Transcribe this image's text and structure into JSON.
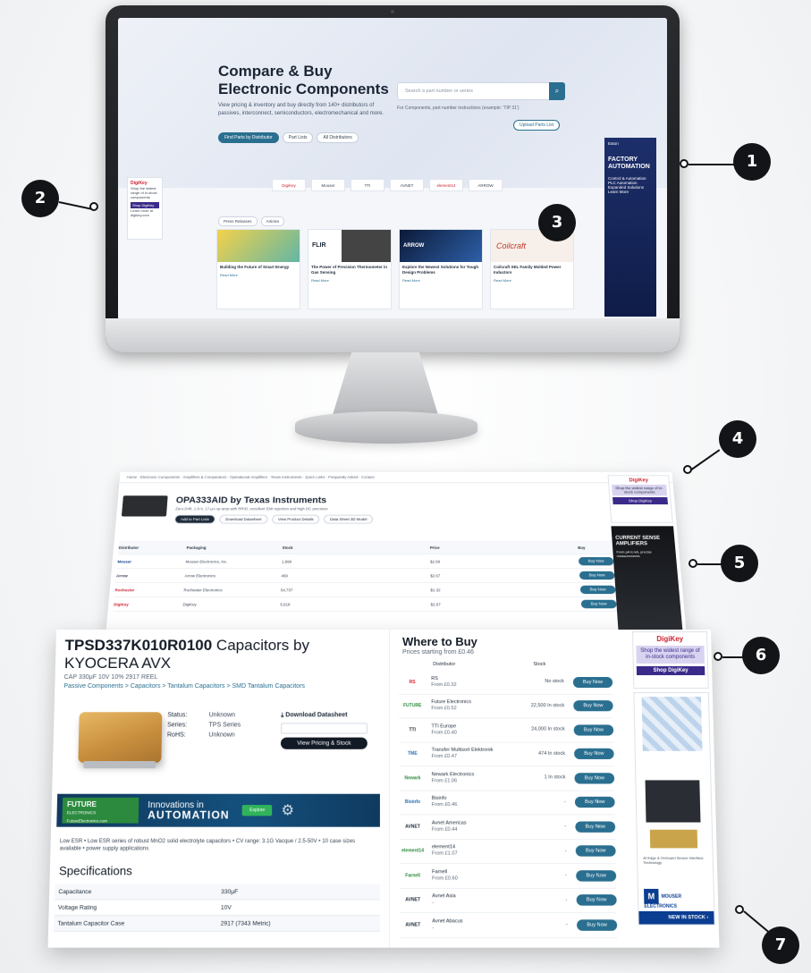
{
  "monitor": {
    "hero": {
      "title": "Compare & Buy Electronic Components",
      "subtitle": "View pricing & inventory and buy directly from 140+ distributors of passives, interconnect, semiconductors, electromechanical and more.",
      "buttons": [
        "Find Parts by Distributor",
        "Part Lists",
        "All Distributors"
      ],
      "search_placeholder": "Search a part number or series",
      "search_note": "For Components, part number instructions (example: 'TIP 31')",
      "upload_label": "Upload Parts List"
    },
    "ad_left": {
      "brand": "DigiKey",
      "text": "Shop the widest range of in-stock components",
      "cta": "Shop DigiKey",
      "note": "Learn more at digikey.com"
    },
    "ad_right": {
      "brand": "Eaton",
      "title": "FACTORY AUTOMATION",
      "items": [
        "Control & Automation",
        "PLC Automation",
        "Expanded Solutions",
        "Learn More"
      ]
    },
    "logos": [
      "DigiKey",
      "Mouser",
      "TTI",
      "AVNET",
      "element14",
      "ARROW"
    ],
    "tabs": [
      "Press Releases",
      "Articles"
    ],
    "cards": [
      {
        "title": "Building the Future of Smart Energy",
        "more": "Read More"
      },
      {
        "title": "The Power of Precision Thermometer in Gas Sensing",
        "more": "Read More"
      },
      {
        "title": "Explore the Newest Solutions for Tough Design Problems",
        "more": "Read More"
      },
      {
        "title": "Coilcraft XEL Family Molded Power Inductors",
        "more": "Read More"
      }
    ],
    "card_brands": [
      "",
      "FLIR",
      "ARROW",
      "Coilcraft"
    ]
  },
  "page1": {
    "nav": "Home · Electronic Components · Amplifiers & Comparators · Operational Amplifiers · Texas Instruments · Quick Links · Frequently Asked · Contact",
    "title": "OPA333AID by Texas Instruments",
    "desc": "Zero-Drift, 1.8-V, 17-μA op amp with RRIO, excellent EMI rejection and high DC precision",
    "buttons": [
      "Add to Part Lists",
      "Download Datasheet",
      "View Product Details",
      "Data Sheet 3D Model"
    ],
    "headers": [
      "Distributor",
      "Packaging",
      "Stock",
      "Price",
      "Buy"
    ],
    "rows": [
      {
        "dist": "Mouser",
        "name": "Mouser Electronics, Inc.",
        "stock": "1,999",
        "price": "$2.58",
        "buy": "Buy Now"
      },
      {
        "dist": "Arrow",
        "name": "Arrow Electronics",
        "stock": "469",
        "price": "$2.67",
        "buy": "Buy Now"
      },
      {
        "dist": "Rochester",
        "name": "Rochester Electronics",
        "stock": "54,737",
        "price": "$1.32",
        "buy": "Buy Now"
      },
      {
        "dist": "DigiKey",
        "name": "DigiKey",
        "stock": "5,618",
        "price": "$2.67",
        "buy": "Buy Now"
      }
    ],
    "ad1": {
      "brand": "DigiKey",
      "text": "Shop the widest range of in-stock components",
      "cta": "Shop DigiKey"
    },
    "ad2": {
      "title": "CURRENT SENSE AMPLIFIERS",
      "sub": "From pA to kA, precise measurements"
    }
  },
  "page2": {
    "title_bold": "TPSD337K010R0100",
    "title_rest": " Capacitors by KYOCERA AVX",
    "meta": "CAP 330μF 10V 10% 2917 REEL",
    "crumbs": "Passive Components > Capacitors > Tantalum Capacitors > SMD Tantalum Capacitors",
    "status": [
      {
        "k": "Status:",
        "v": "Unknown"
      },
      {
        "k": "Series:",
        "v": "TPS Series"
      },
      {
        "k": "RoHS:",
        "v": "Unknown"
      }
    ],
    "download_label": "Download Datasheet",
    "view_label": "View Pricing & Stock",
    "banner": {
      "brand": "FUTURE",
      "brand_sub": "ELECTRONICS",
      "url": "FutureElectronics.com",
      "line1": "Innovations in",
      "line2": "AUTOMATION",
      "cta": "Explore"
    },
    "desc": "Low ESR • Low ESR series of robust MnO2 solid electrolyte capacitors • CV range: 3.1G Vacque / 2.5-50V • 10 case sizes available • power supply applications",
    "spec_title": "Specifications",
    "specs": [
      {
        "k": "Capacitance",
        "v": "330μF"
      },
      {
        "k": "Voltage Rating",
        "v": "10V"
      },
      {
        "k": "Tantalum Capacitor Case",
        "v": "2917 (7343 Metric)"
      }
    ],
    "wtb": {
      "title": "Where to Buy",
      "sub": "Prices starting from £0.46",
      "col_dist": "Distributor",
      "col_stock": "Stock",
      "rows": [
        {
          "logo": "RS",
          "logo_color": "#e01e26",
          "name": "RS",
          "from": "From £0.32",
          "stock": "No stock",
          "buy": "Buy Now"
        },
        {
          "logo": "FUTURE",
          "logo_color": "#2b8a3e",
          "name": "Future Electronics",
          "from": "From £0.52",
          "stock": "22,500 In stock",
          "buy": "Buy Now"
        },
        {
          "logo": "TTI",
          "logo_color": "#1e2b3a",
          "name": "TTI Europe",
          "from": "From £0.40",
          "stock": "24,000 In stock",
          "buy": "Buy Now"
        },
        {
          "logo": "TME",
          "logo_color": "#2a6fb0",
          "name": "Transfer Multisort Elektronik",
          "from": "From £0.47",
          "stock": "474 In stock",
          "buy": "Buy Now"
        },
        {
          "logo": "Newark",
          "logo_color": "#2b8a3e",
          "name": "Newark Electronics",
          "from": "From £1.06",
          "stock": "1 In stock",
          "buy": "Buy Now"
        },
        {
          "logo": "Bisinfo",
          "logo_color": "#2a6fb0",
          "name": "Bisinfo",
          "from": "From £0.46",
          "stock": "-",
          "buy": "Buy Now"
        },
        {
          "logo": "AVNET",
          "logo_color": "#1e2b3a",
          "name": "Avnet Americas",
          "from": "From £0.44",
          "stock": "-",
          "buy": "Buy Now"
        },
        {
          "logo": "element14",
          "logo_color": "#2b8a3e",
          "name": "element14",
          "from": "From £1.07",
          "stock": "-",
          "buy": "Buy Now"
        },
        {
          "logo": "Farnell",
          "logo_color": "#2b8a3e",
          "name": "Farnell",
          "from": "From £0.60",
          "stock": "-",
          "buy": "Buy Now"
        },
        {
          "logo": "AVNET",
          "logo_color": "#1e2b3a",
          "name": "Avnet Asia",
          "from": "-",
          "stock": "-",
          "buy": "Buy Now"
        },
        {
          "logo": "AVNET",
          "logo_color": "#1e2b3a",
          "name": "Avnet Abacus",
          "from": "-",
          "stock": "-",
          "buy": "Buy Now"
        }
      ]
    },
    "ad1": {
      "brand": "DigiKey",
      "text": "Shop the widest range of in-stock components",
      "cta": "Shop DigiKey"
    },
    "ad2": {
      "text": "AI Edge & OnGuard Sensor Interface Technology",
      "brand": "MOUSER ELECTRONICS",
      "cta": "NEW IN STOCK ›"
    }
  },
  "callouts": [
    "1",
    "2",
    "3",
    "4",
    "5",
    "6",
    "7"
  ]
}
